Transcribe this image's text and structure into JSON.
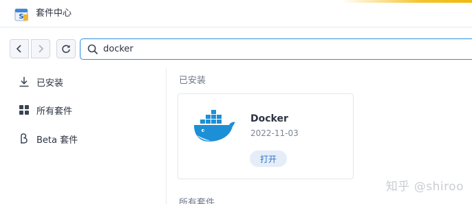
{
  "window": {
    "title": "套件中心"
  },
  "toolbar": {
    "search_value": "docker"
  },
  "sidebar": {
    "items": [
      {
        "label": "已安装",
        "icon": "download-icon"
      },
      {
        "label": "所有套件",
        "icon": "grid-icon"
      },
      {
        "label": "Beta 套件",
        "icon": "beta-icon"
      }
    ]
  },
  "main": {
    "installed_heading": "已安装",
    "all_packages_heading": "所有套件",
    "package": {
      "name": "Docker",
      "date": "2022-11-03",
      "open_label": "打开",
      "icon": "docker-whale-icon"
    }
  },
  "watermark": "知乎 @shiroo",
  "colors": {
    "accent": "#2d8ce0",
    "docker_blue": "#1d8fd6",
    "title_bar_accent": "#f4c430"
  }
}
